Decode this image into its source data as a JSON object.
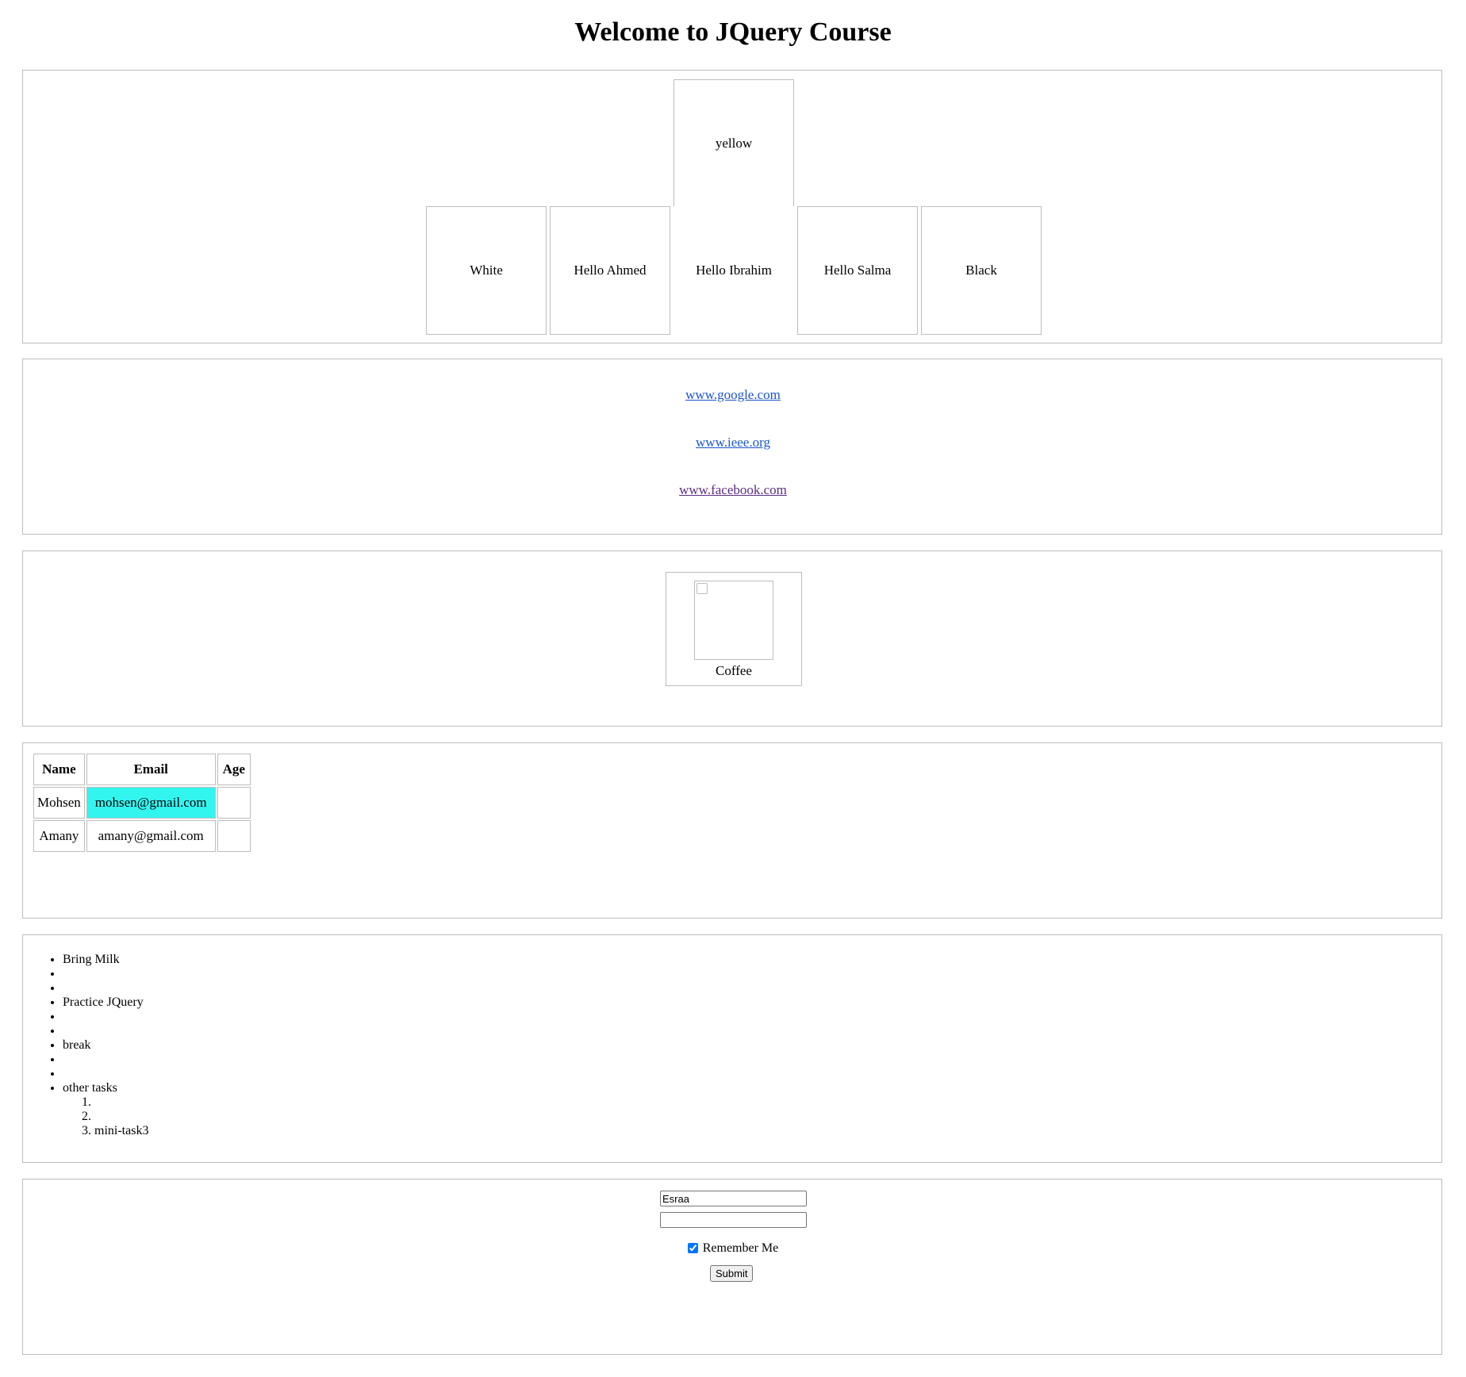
{
  "heading": "Welcome to JQuery Course",
  "boxes": {
    "top": "yellow",
    "row": [
      "White",
      "Hello Ahmed",
      "Hello Ibrahim",
      "Hello Salma",
      "Black"
    ]
  },
  "links": [
    {
      "text": "www.google.com",
      "visited": false
    },
    {
      "text": "www.ieee.org",
      "visited": false
    },
    {
      "text": "www.facebook.com",
      "visited": true
    }
  ],
  "figure": {
    "caption": "Coffee"
  },
  "table": {
    "headers": [
      "Name",
      "Email",
      "Age"
    ],
    "rows": [
      {
        "name": "Mohsen",
        "email": "mohsen@gmail.com",
        "age": "",
        "highlight_email": true
      },
      {
        "name": "Amany",
        "email": "amany@gmail.com",
        "age": "",
        "highlight_email": false
      }
    ],
    "highlight_color": "#33f5f0"
  },
  "tasks": {
    "items": [
      "Bring Milk",
      "",
      "",
      "Practice JQuery",
      "",
      "",
      "break",
      "",
      "",
      "other tasks"
    ],
    "subitems": [
      "",
      "",
      "mini-task3"
    ]
  },
  "form": {
    "username_value": "Esraa",
    "password_value": "",
    "remember_label": "Remember Me",
    "remember_checked": true,
    "submit_label": "Submit"
  },
  "colors": {
    "link": "#1a55cc",
    "visited_link": "#5a2d82",
    "border": "#bdbdbd"
  }
}
